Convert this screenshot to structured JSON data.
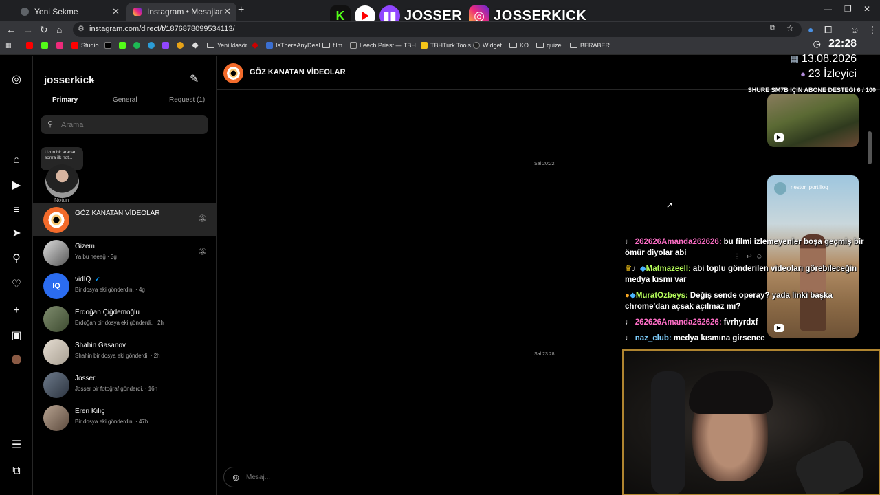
{
  "browser": {
    "tabs": [
      {
        "label": "Yeni Sekme",
        "close": "✕"
      },
      {
        "label": "Instagram • Mesajlar",
        "close": "✕"
      }
    ],
    "new_tab": "+",
    "url": "instagram.com/direct/t/1876878099534113/",
    "bookmarks": [
      "Studio",
      "Yeni klasör",
      "IsThereAnyDeal",
      "film",
      "Leech Priest — TBH...",
      "TBHTurk Tools",
      "Widget",
      "KO",
      "quizei",
      "BERABER"
    ]
  },
  "overlay": {
    "name1": "JOSSER",
    "name2": "JOSSERKICK",
    "clock": "22:28",
    "date": "13.08.2026",
    "viewers": "23 İzleyici",
    "sub_goal": "SHURE SM7B İÇİN ABONE DESTEĞİ 6 / 100"
  },
  "inbox": {
    "username": "josserkick",
    "tabs": {
      "primary": "Primary",
      "general": "General",
      "request": "Request (1)"
    },
    "search_placeholder": "Arama",
    "note_text": "Uzun bir aradan sonra ilk not...",
    "note_label": "Notun",
    "conversations": [
      {
        "name": "GÖZ KANATAN VİDEOLAR",
        "meta": ""
      },
      {
        "name": "Gizem",
        "meta": "Ya bu neeeğ · 3g"
      },
      {
        "name": "vidIQ",
        "meta": "Bir dosya eki gönderdin. · 4g"
      },
      {
        "name": "Erdoğan Çiğdemoğlu",
        "meta": "Erdoğan bir dosya eki gönderdi. · 2h"
      },
      {
        "name": "Shahin Gasanov",
        "meta": "Shahin bir dosya eki gönderdi. · 2h"
      },
      {
        "name": "Josser",
        "meta": "Josser bir fotoğraf gönderdi. · 16h"
      },
      {
        "name": "Eren Kılıç",
        "meta": "Bir dosya eki gönderdin. · 47h"
      }
    ]
  },
  "chat": {
    "title": "GÖZ KANATAN VİDEOLAR",
    "timestamp1": "Sal 20:22",
    "timestamp2": "Sal 23:28",
    "reel_user": "nestor_portilloq",
    "composer_placeholder": "Mesaj..."
  },
  "stream_chat": [
    {
      "user": "262626Amanda262626:",
      "text": "bu filmi izlemeyenler boşa geçmiş bir ömür diyolar abi",
      "color": "#ff6ec7"
    },
    {
      "user": "Matmazeell:",
      "text": "abi toplu gönderilen videoları görebileceğin medya kısmı var",
      "color": "#b7ff5a"
    },
    {
      "user": "MuratOzbeys:",
      "text": "Değiş sende operay? yada linki başka chrome'dan açsak açılmaz mı?",
      "color": "#b7ff5a"
    },
    {
      "user": "262626Amanda262626:",
      "text": "fvrhyrdxf",
      "color": "#ff6ec7"
    },
    {
      "user": "naz_club:",
      "text": "medya kısmına girsenee",
      "color": "#7fd0ff"
    }
  ],
  "colors": {
    "accent": "#0095f6",
    "bg": "#000000",
    "surface": "#262626"
  }
}
